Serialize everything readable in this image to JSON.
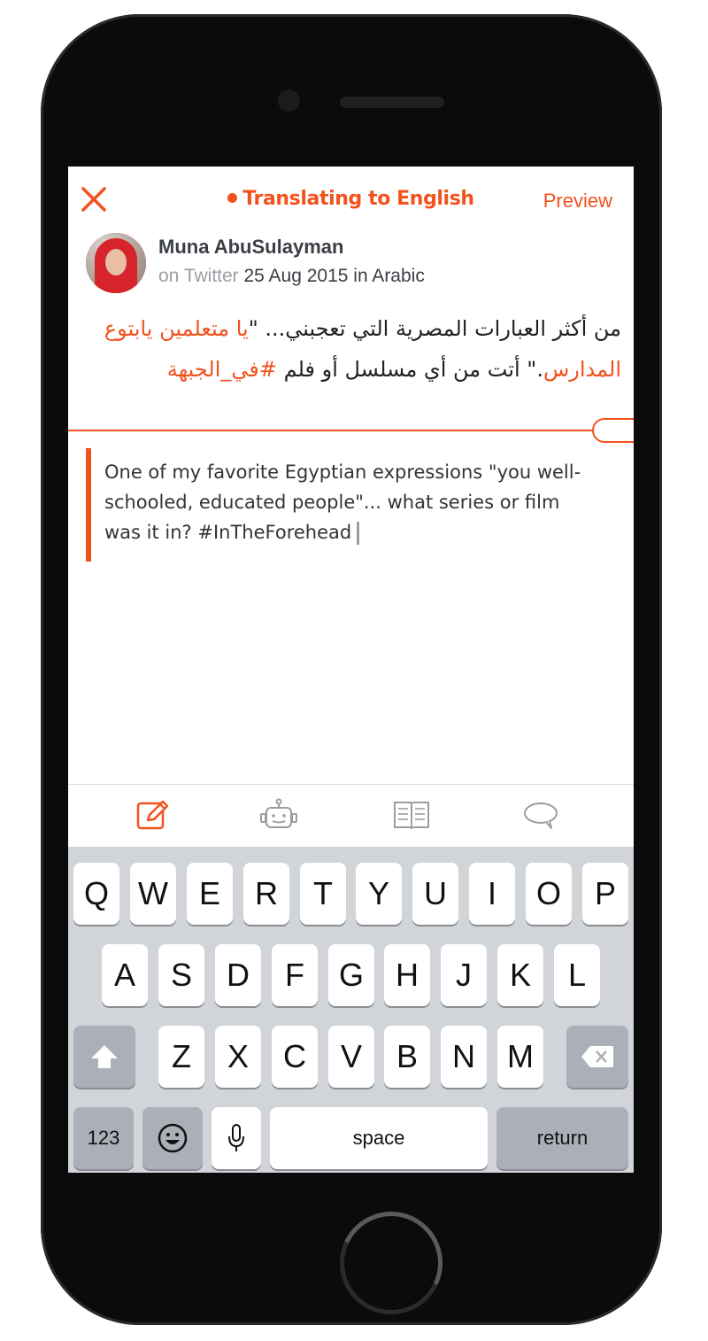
{
  "header": {
    "mode_label": "Translating to English",
    "preview_label": "Preview"
  },
  "post": {
    "author": "Muna AbuSulayman",
    "source_prefix": "on Twitter",
    "date_lang": "25 Aug 2015 in Arabic",
    "arabic_part1": "من أكثر العبارات المصرية التي تعجبني... \"",
    "arabic_quote": "يا متعلمين يابتوع المدارس",
    "arabic_part2": ".\" أتت من أي مسلسل أو فلم ",
    "arabic_hashtag": "#في_الجبهة"
  },
  "translation": {
    "text": "One of my favorite Egyptian expressions \"you well-schooled, educated people\"...  what series or film was it in? #InTheForehead"
  },
  "toolbar": {
    "icons": [
      "edit-icon",
      "robot-icon",
      "book-icon",
      "comment-icon"
    ]
  },
  "keyboard": {
    "row1": [
      "Q",
      "W",
      "E",
      "R",
      "T",
      "Y",
      "U",
      "I",
      "O",
      "P"
    ],
    "row2": [
      "A",
      "S",
      "D",
      "F",
      "G",
      "H",
      "J",
      "K",
      "L"
    ],
    "row3": [
      "Z",
      "X",
      "C",
      "V",
      "B",
      "N",
      "M"
    ],
    "numbers_label": "123",
    "space_label": "space",
    "return_label": "return"
  },
  "colors": {
    "accent": "#f2521e",
    "keyboard_bg": "#d1d4d9",
    "dark_key": "#abb0b8"
  }
}
